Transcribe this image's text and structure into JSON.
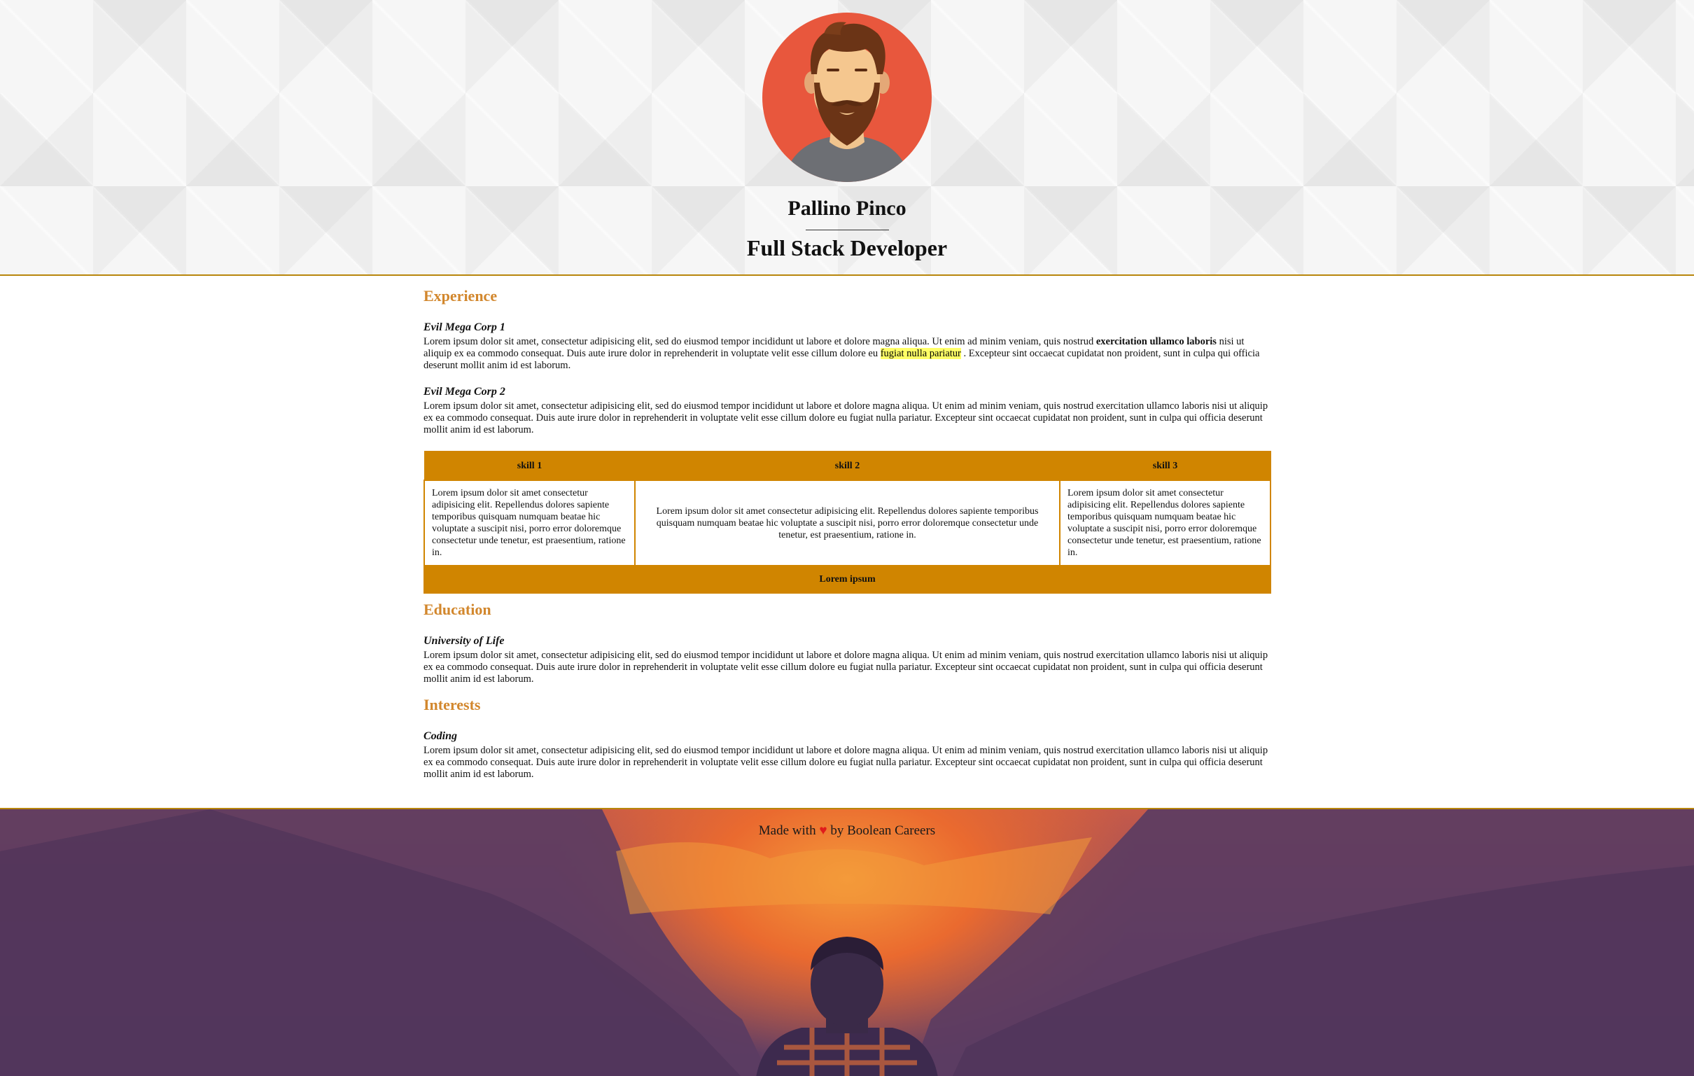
{
  "header": {
    "name": "Pallino Pinco",
    "role": "Full Stack Developer"
  },
  "colors": {
    "accent": "#d2872d",
    "table": "#d08500",
    "highlight": "#ffff66",
    "heart": "#e01b1b",
    "avatar_bg": "#e8573d"
  },
  "experience": {
    "title": "Experience",
    "entries": [
      {
        "title": "Evil Mega Corp 1",
        "text_a": "Lorem ipsum dolor sit amet, consectetur adipisicing elit, sed do eiusmod tempor incididunt ut labore et dolore magna aliqua. Ut enim ad minim veniam, quis nostrud ",
        "bold": "exercitation ullamco laboris",
        "text_b": " nisi ut aliquip ex ea commodo consequat. Duis aute irure dolor in reprehenderit in voluptate velit esse cillum dolore eu ",
        "highlight": "fugiat nulla pariatur",
        "text_c": " . Excepteur sint occaecat cupidatat non proident, sunt in culpa qui officia deserunt mollit anim id est laborum."
      },
      {
        "title": "Evil Mega Corp 2",
        "text": "Lorem ipsum dolor sit amet, consectetur adipisicing elit, sed do eiusmod tempor incididunt ut labore et dolore magna aliqua. Ut enim ad minim veniam, quis nostrud exercitation ullamco laboris nisi ut aliquip ex ea commodo consequat. Duis aute irure dolor in reprehenderit in voluptate velit esse cillum dolore eu fugiat nulla pariatur. Excepteur sint occaecat cupidatat non proident, sunt in culpa qui officia deserunt mollit anim id est laborum."
      }
    ]
  },
  "skills": {
    "headers": [
      "skill 1",
      "skill 2",
      "skill 3"
    ],
    "cells": [
      "Lorem ipsum dolor sit amet consectetur adipisicing elit. Repellendus dolores sapiente temporibus quisquam numquam beatae hic voluptate a suscipit nisi, porro error doloremque consectetur unde tenetur, est praesentium, ratione in.",
      "Lorem ipsum dolor sit amet consectetur adipisicing elit. Repellendus dolores sapiente temporibus quisquam numquam beatae hic voluptate a suscipit nisi, porro error doloremque consectetur unde tenetur, est praesentium, ratione in.",
      "Lorem ipsum dolor sit amet consectetur adipisicing elit. Repellendus dolores sapiente temporibus quisquam numquam beatae hic voluptate a suscipit nisi, porro error doloremque consectetur unde tenetur, est praesentium, ratione in."
    ],
    "footer": "Lorem ipsum"
  },
  "education": {
    "title": "Education",
    "entry_title": "University of Life",
    "text": "Lorem ipsum dolor sit amet, consectetur adipisicing elit, sed do eiusmod tempor incididunt ut labore et dolore magna aliqua. Ut enim ad minim veniam, quis nostrud exercitation ullamco laboris nisi ut aliquip ex ea commodo consequat. Duis aute irure dolor in reprehenderit in voluptate velit esse cillum dolore eu fugiat nulla pariatur. Excepteur sint occaecat cupidatat non proident, sunt in culpa qui officia deserunt mollit anim id est laborum."
  },
  "interests": {
    "title": "Interests",
    "entry_title": "Coding",
    "text": "Lorem ipsum dolor sit amet, consectetur adipisicing elit, sed do eiusmod tempor incididunt ut labore et dolore magna aliqua. Ut enim ad minim veniam, quis nostrud exercitation ullamco laboris nisi ut aliquip ex ea commodo consequat. Duis aute irure dolor in reprehenderit in voluptate velit esse cillum dolore eu fugiat nulla pariatur. Excepteur sint occaecat cupidatat non proident, sunt in culpa qui officia deserunt mollit anim id est laborum."
  },
  "footer": {
    "prefix": "Made with",
    "heart": "♥",
    "suffix": "by Boolean Careers"
  }
}
